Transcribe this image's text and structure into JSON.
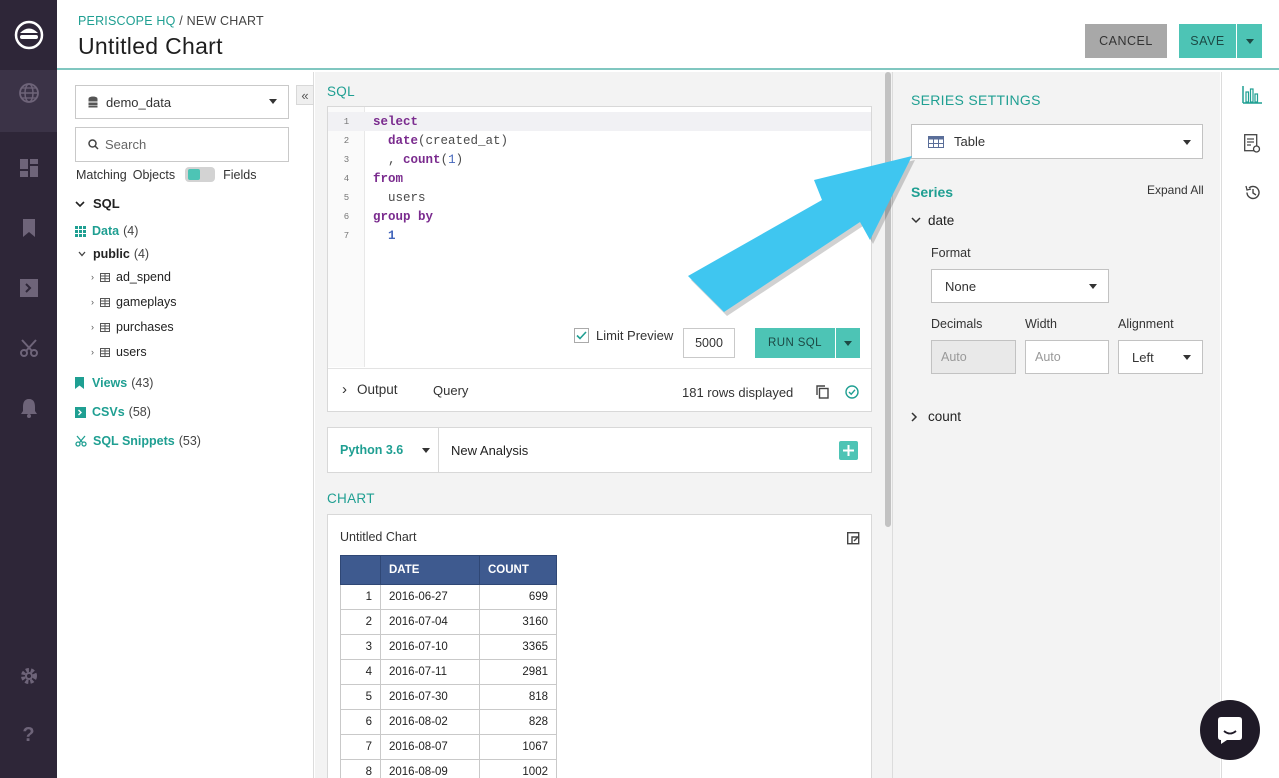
{
  "header": {
    "breadcrumb_home": "PERISCOPE HQ",
    "breadcrumb_sep": " / ",
    "breadcrumb_page": "NEW CHART",
    "title": "Untitled Chart",
    "cancel_label": "CANCEL",
    "save_label": "SAVE"
  },
  "leftnav": {
    "icons": [
      "logo-icon",
      "globe-icon",
      "dashboard-icon",
      "bookmark-icon",
      "terminal-icon",
      "scissors-icon",
      "bell-icon",
      "gear-icon",
      "help-icon"
    ]
  },
  "schema": {
    "database": "demo_data",
    "search_placeholder": "Search",
    "matching_label": "Matching",
    "objects_label": "Objects",
    "fields_label": "Fields",
    "sql_label": "SQL",
    "data_label": "Data",
    "data_count": "(4)",
    "public_label": "public",
    "public_count": "(4)",
    "tables": [
      "ad_spend",
      "gameplays",
      "purchases",
      "users"
    ],
    "views_label": "Views",
    "views_count": "(43)",
    "csvs_label": "CSVs",
    "csvs_count": "(58)",
    "snippets_label": "SQL Snippets",
    "snippets_count": "(53)"
  },
  "sql": {
    "section_label": "SQL",
    "line_numbers": [
      "1",
      "2",
      "3",
      "4",
      "5",
      "6",
      "7"
    ],
    "limit_label": "Limit Preview",
    "limit_value": "5000",
    "run_label": "RUN SQL",
    "output_label": "Output",
    "query_label": "Query",
    "rows_status": "181 rows displayed"
  },
  "python": {
    "version": "Python 3.6",
    "analysis_name": "New Analysis"
  },
  "chart": {
    "section_label": "CHART",
    "title": "Untitled Chart",
    "columns": [
      "DATE",
      "COUNT"
    ],
    "rows": [
      {
        "idx": "1",
        "date": "2016-06-27",
        "count": "699"
      },
      {
        "idx": "2",
        "date": "2016-07-04",
        "count": "3160"
      },
      {
        "idx": "3",
        "date": "2016-07-10",
        "count": "3365"
      },
      {
        "idx": "4",
        "date": "2016-07-11",
        "count": "2981"
      },
      {
        "idx": "5",
        "date": "2016-07-30",
        "count": "818"
      },
      {
        "idx": "6",
        "date": "2016-08-02",
        "count": "828"
      },
      {
        "idx": "7",
        "date": "2016-08-07",
        "count": "1067"
      },
      {
        "idx": "8",
        "date": "2016-08-09",
        "count": "1002"
      }
    ]
  },
  "settings": {
    "heading": "SERIES SETTINGS",
    "chart_type": "Table",
    "series_label": "Series",
    "expand_all": "Expand All",
    "series_date": "date",
    "format_label": "Format",
    "format_value": "None",
    "decimals_label": "Decimals",
    "decimals_placeholder": "Auto",
    "width_label": "Width",
    "width_placeholder": "Auto",
    "alignment_label": "Alignment",
    "alignment_value": "Left",
    "series_count": "count"
  },
  "colors": {
    "accent": "#4dc4b5",
    "teal_text": "#1f9f92",
    "nav_bg": "#2e2638",
    "table_header": "#3e5a8f",
    "arrow": "#3fc6f0"
  }
}
